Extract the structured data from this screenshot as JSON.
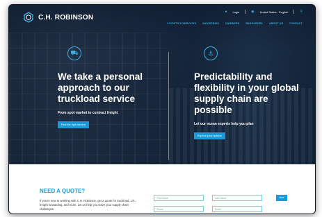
{
  "brand": {
    "name": "C.H. ROBINSON"
  },
  "utility": {
    "login": "Login",
    "region": "United States - English"
  },
  "nav": {
    "items": [
      "LOGISTICS SERVICES",
      "INDUSTRIES",
      "CARRIERS",
      "RESOURCES",
      "ABOUT US",
      "CONTACT"
    ]
  },
  "hero": {
    "left": {
      "icon": "truck-icon",
      "headline": "We take a personal approach to our truckload service",
      "subtext": "From spot market to contract freight",
      "cta": "Find the right service"
    },
    "right": {
      "icon": "ship-icon",
      "headline": "Predictability and flexibility in your global supply chain are possible",
      "subtext": "Let our ocean experts help you plan",
      "cta": "Explore your options"
    }
  },
  "quote": {
    "title": "NEED A QUOTE?",
    "body": "If you're new to working with C.H. Robinson, get a quote for truckload, LTL, freight forwarding, and more. Let us help you solve your supply chain challenges.",
    "fields": {
      "first_name": "First Name",
      "last_name": "Last Name",
      "phone": "Phone",
      "email": "Email"
    },
    "submit": "Next"
  },
  "colors": {
    "accent": "#1a9ad9",
    "nav": "#3db3e6",
    "header_bg": "#0f1f33"
  }
}
